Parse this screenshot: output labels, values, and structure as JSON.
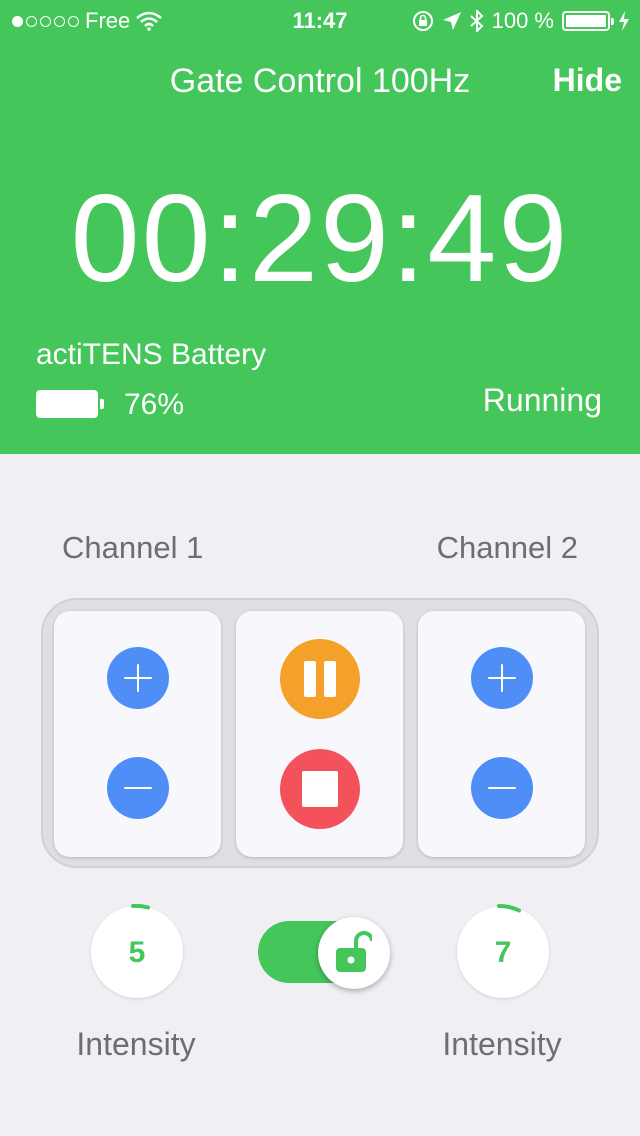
{
  "status_bar": {
    "carrier": "Free",
    "time": "11:47",
    "battery_pct": "100 %",
    "signal_dots": [
      true,
      false,
      false,
      false,
      false
    ],
    "icons": [
      "wifi-icon",
      "rotation-lock-icon",
      "location-icon",
      "bluetooth-icon",
      "charging-icon"
    ]
  },
  "header": {
    "title": "Gate Control 100Hz",
    "hide_label": "Hide",
    "timer": "00:29:49",
    "battery_label": "actiTENS Battery",
    "battery_pct": "76%",
    "run_status": "Running",
    "bg_color": "#44c65a"
  },
  "channels": {
    "left_label": "Channel 1",
    "right_label": "Channel 2"
  },
  "controls": {
    "accent_blue": "#4f8ef7",
    "pause_color": "#f5a02b",
    "stop_color": "#f3525b"
  },
  "intensity": {
    "channel1_value": "5",
    "channel2_value": "7",
    "label": "Intensity"
  },
  "lock": {
    "unlocked": true
  }
}
